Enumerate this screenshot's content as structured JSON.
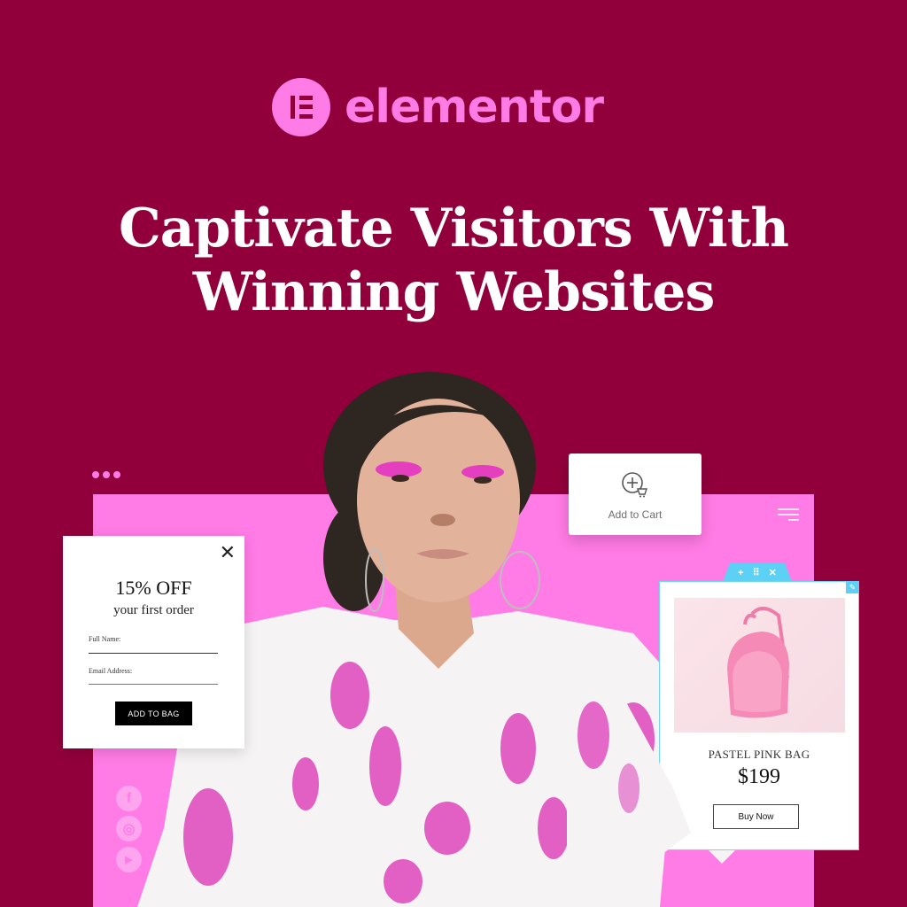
{
  "brand": {
    "name": "elementor",
    "logo_icon": "elementor-e-icon",
    "accent_color": "#ff7be5",
    "background_color": "#92003b"
  },
  "headline": {
    "line1": "Captivate Visitors With",
    "line2": "Winning Websites"
  },
  "canvas": {
    "window_dots_icon": "three-dots-icon",
    "menu_icon": "hamburger-menu-icon",
    "social_icons": [
      {
        "name": "facebook-icon",
        "glyph": "f"
      },
      {
        "name": "instagram-icon",
        "glyph": "◎"
      },
      {
        "name": "youtube-icon",
        "glyph": "▶"
      }
    ]
  },
  "popup": {
    "close_glyph": "✕",
    "offer": "15% OFF",
    "subtitle": "your first order",
    "fields": [
      {
        "label": "Full Name:",
        "value": ""
      },
      {
        "label": "Email Address:",
        "value": ""
      }
    ],
    "button_label": "ADD TO BAG"
  },
  "cart_widget": {
    "icon": "add-to-cart-icon",
    "label": "Add to Cart"
  },
  "product_card": {
    "toolbar": {
      "add_glyph": "+",
      "drag_glyph": "⠿",
      "close_glyph": "✕",
      "edit_glyph": "✎"
    },
    "image_alt": "pastel pink backpack",
    "name": "PASTEL PINK BAG",
    "price": "$199",
    "button_label": "Buy Now"
  }
}
